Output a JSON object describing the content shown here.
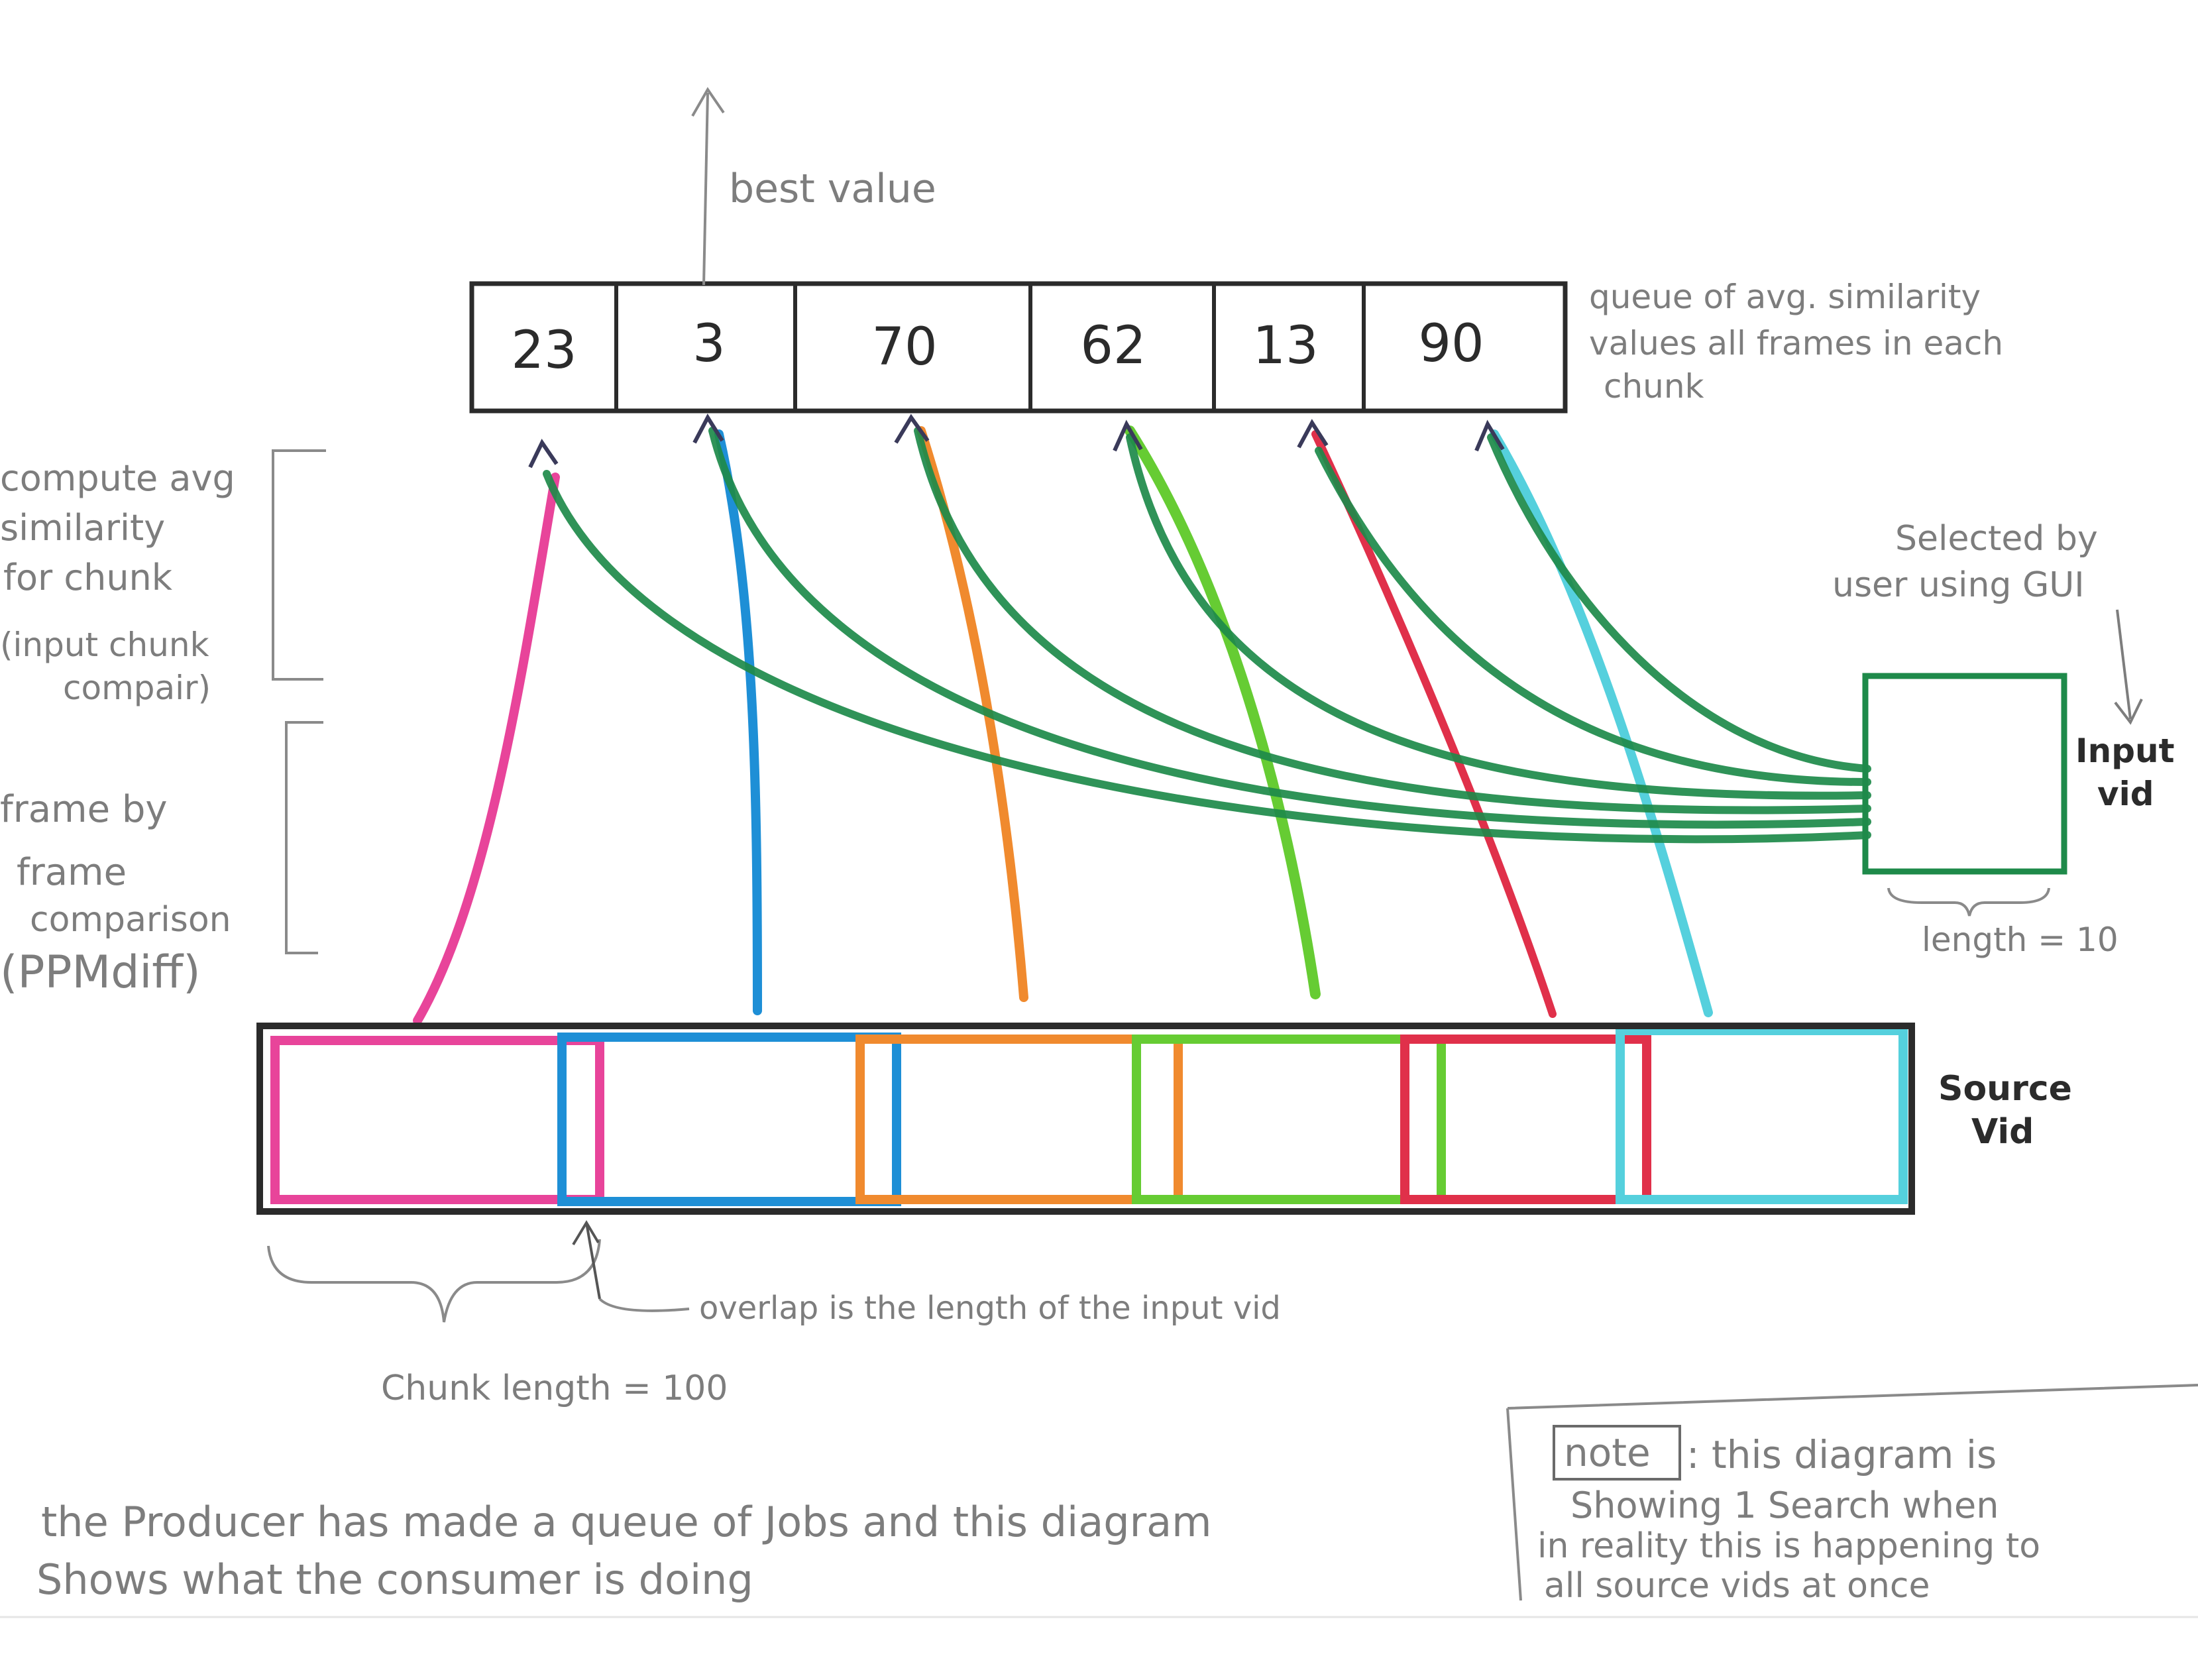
{
  "queue": {
    "values": [
      "23",
      "3",
      "70",
      "62",
      "13",
      "90"
    ],
    "label_lines": [
      "queue of avg. similarity",
      "values all frames in each",
      "chunk"
    ]
  },
  "best_value": "best value",
  "left_labels": {
    "compute_lines": [
      "compute avg",
      "similarity",
      "for chunk",
      "(input chunk",
      "compair)"
    ],
    "frame_lines": [
      "frame by",
      "frame",
      "comparison",
      "(PPMdiff)"
    ]
  },
  "input_vid": {
    "selected_lines": [
      "Selected by",
      "user using GUI"
    ],
    "label_lines": [
      "Input",
      "vid"
    ],
    "length": "length = 10"
  },
  "source_vid": {
    "label_lines": [
      "Source",
      "Vid"
    ]
  },
  "overlap_note": "overlap is the length of the input vid",
  "chunk_length": "Chunk length = 100",
  "footer": {
    "lines": [
      "the Producer has made a queue of Jobs and this diagram",
      "Shows what the consumer is doing"
    ]
  },
  "note_box": {
    "tag": "note",
    "lines": [
      ": this diagram is",
      "Showing 1 Search when",
      "in reality this is happening to",
      "all source vids at once"
    ]
  },
  "colors": {
    "ink": "#2b2b2b",
    "pencil": "#8a8a8a",
    "pink": "#e8449a",
    "blue": "#1e8fd6",
    "orange": "#f08a2e",
    "lime": "#66cc33",
    "red": "#e0304a",
    "cyan": "#55d0dd",
    "green": "#1e8a4a"
  }
}
